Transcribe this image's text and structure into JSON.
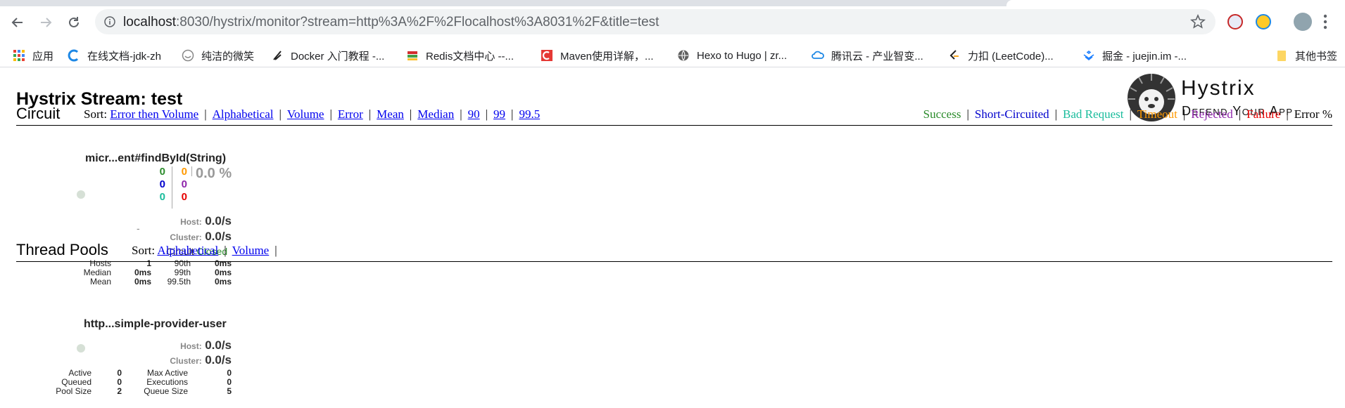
{
  "browser": {
    "url_host": "localhost",
    "url_rest": ":8030/hystrix/monitor?stream=http%3A%2F%2Flocalhost%3A8031%2F&title=test"
  },
  "bookmarks": [
    {
      "label": "应用",
      "icon": "apps-grid-icon"
    },
    {
      "label": "在线文档-jdk-zh",
      "icon": "c-logo-icon"
    },
    {
      "label": "纯洁的微笑",
      "icon": "smile-icon"
    },
    {
      "label": "Docker 入门教程 -...",
      "icon": "brush-icon"
    },
    {
      "label": "Redis文档中心 --...",
      "icon": "redis-icon"
    },
    {
      "label": "Maven使用详解，...",
      "icon": "csdn-icon"
    },
    {
      "label": "Hexo to Hugo | zr...",
      "icon": "globe-icon"
    },
    {
      "label": "腾讯云 - 产业智变...",
      "icon": "cloud-icon"
    },
    {
      "label": "力扣 (LeetCode)...",
      "icon": "leetcode-icon"
    },
    {
      "label": "掘金 - juejin.im -...",
      "icon": "juejin-icon"
    },
    {
      "label": "其他书签",
      "icon": "folder-icon"
    }
  ],
  "page": {
    "title": "Hystrix Stream: test",
    "logo_line1": "Hystrix",
    "logo_line2": "Defend Your App"
  },
  "circuit": {
    "title": "Circuit",
    "sort_label": "Sort:",
    "sort_options": [
      "Error then Volume",
      "Alphabetical",
      "Volume",
      "Error",
      "Mean",
      "Median",
      "90",
      "99",
      "99.5"
    ],
    "legend": [
      {
        "label": "Success",
        "color": "#2c8c2c"
      },
      {
        "label": "Short-Circuited",
        "color": "#0000cc"
      },
      {
        "label": "Bad Request",
        "color": "#1abc9c"
      },
      {
        "label": "Timeout",
        "color": "#ff9900"
      },
      {
        "label": "Rejected",
        "color": "#8e24aa"
      },
      {
        "label": "Failure",
        "color": "#e60000"
      },
      {
        "label": "Error %",
        "color": "#000000"
      }
    ],
    "monitor": {
      "name": "micr...ent#findById(String)",
      "success": "0",
      "short_circuited": "0",
      "bad_request": "0",
      "timeout": "0",
      "rejected": "0",
      "failure": "0",
      "error_pct": "0.0 %",
      "trend": "-",
      "host_label": "Host:",
      "host_rate": "0.0/s",
      "cluster_label": "Cluster:",
      "cluster_rate": "0.0/s",
      "circuit_label": "Circuit",
      "circuit_state": "Closed",
      "stats": {
        "hosts_label": "Hosts",
        "hosts": "1",
        "median_label": "Median",
        "median": "0ms",
        "mean_label": "Mean",
        "mean": "0ms",
        "p90_label": "90th",
        "p90": "0ms",
        "p99_label": "99th",
        "p99": "0ms",
        "p995_label": "99.5th",
        "p995": "0ms"
      }
    }
  },
  "thread_pools": {
    "title": "Thread Pools",
    "sort_label": "Sort:",
    "sort_options": [
      "Alphabetical",
      "Volume"
    ],
    "monitor": {
      "name": "http...simple-provider-user",
      "host_label": "Host:",
      "host_rate": "0.0/s",
      "cluster_label": "Cluster:",
      "cluster_rate": "0.0/s",
      "stats": {
        "active_label": "Active",
        "active": "0",
        "queued_label": "Queued",
        "queued": "0",
        "pool_size_label": "Pool Size",
        "pool_size": "2",
        "max_active_label": "Max Active",
        "max_active": "0",
        "executions_label": "Executions",
        "executions": "0",
        "queue_size_label": "Queue Size",
        "queue_size": "5"
      }
    }
  }
}
